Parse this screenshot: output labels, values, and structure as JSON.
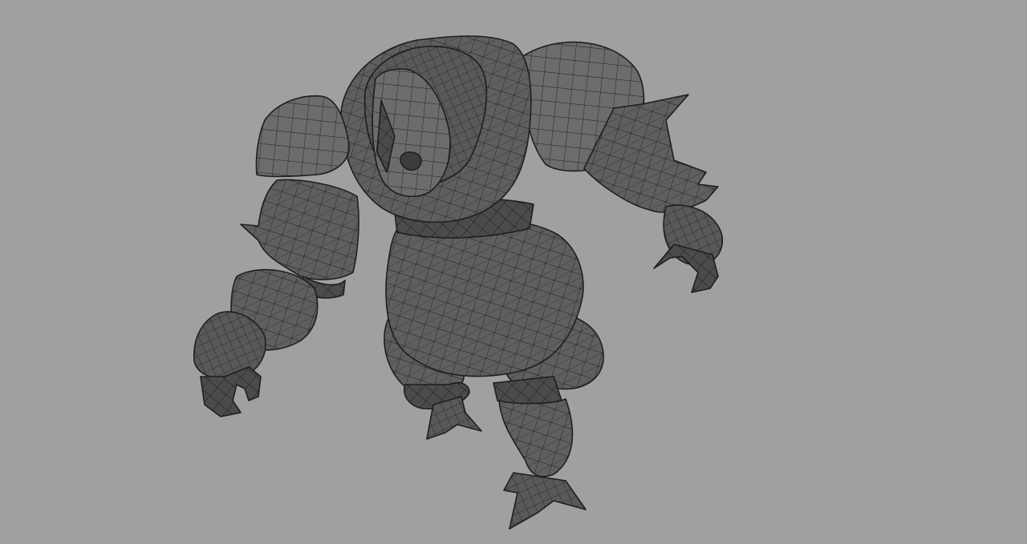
{
  "viewport": {
    "background_color": "#a0a0a0",
    "display_mode": "shaded-with-wireframe"
  },
  "model": {
    "subject": "armored-brute-character",
    "base_color": "#5f5f5f",
    "shade_color": "#4a4a4a",
    "highlight_color": "#727272",
    "wire_color": "#1e1e1e"
  }
}
